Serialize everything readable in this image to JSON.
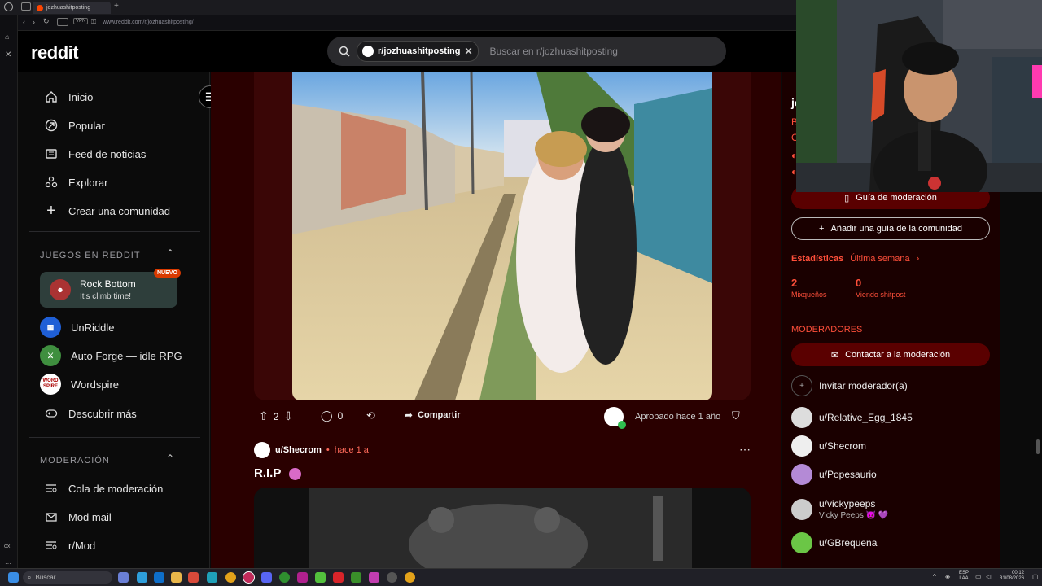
{
  "browser": {
    "tab_title": "jozhuashitposting",
    "url": "www.reddit.com/r/jozhuashitposting/"
  },
  "header": {
    "logo": "reddit",
    "search_chip": "r/jozhuashitposting",
    "search_placeholder": "Buscar en r/jozhuashitposting"
  },
  "sidebar": {
    "nav": [
      {
        "label": "Inicio",
        "icon": "home-icon"
      },
      {
        "label": "Popular",
        "icon": "popular-icon"
      },
      {
        "label": "Feed de noticias",
        "icon": "news-icon"
      },
      {
        "label": "Explorar",
        "icon": "explore-icon"
      },
      {
        "label": "Crear una comunidad",
        "icon": "plus-icon"
      }
    ],
    "games_header": "JUEGOS EN REDDIT",
    "games": [
      {
        "title": "Rock Bottom",
        "subtitle": "It's climb time!",
        "badge": "NUEVO"
      },
      {
        "title": "UnRiddle"
      },
      {
        "title": "Auto Forge — idle RPG"
      },
      {
        "title": "Wordspire",
        "icon_text": "WORD SPIRE"
      },
      {
        "title": "Descubrir más"
      }
    ],
    "mod_header": "MODERACIÓN",
    "mod": [
      {
        "label": "Cola de moderación"
      },
      {
        "label": "Mod mail"
      },
      {
        "label": "r/Mod"
      }
    ]
  },
  "post1": {
    "votes": "2",
    "comments": "0",
    "share": "Compartir",
    "approved": "Aprobado hace 1 año"
  },
  "post2": {
    "author": "u/Shecrom",
    "time": "hace 1 a",
    "title": "R.I.P"
  },
  "right": {
    "title_partial": "jo",
    "partial_letters": [
      "B",
      "C"
    ],
    "mod_guide": "Guía de moderación",
    "add_guide": "Añadir una guía de la comunidad",
    "stats_label": "Estadísticas",
    "stats_period": "Última semana",
    "stat1_value": "2",
    "stat1_label": "Mixqueños",
    "stat2_value": "0",
    "stat2_label": "Viendo shitpost",
    "mods_header": "MODERADORES",
    "contact_mods": "Contactar a la moderación",
    "invite": "Invitar moderador(a)",
    "mods": [
      {
        "name": "u/Relative_Egg_1845",
        "sub": ""
      },
      {
        "name": "u/Shecrom",
        "sub": ""
      },
      {
        "name": "u/Popesaurio",
        "sub": ""
      },
      {
        "name": "u/vickypeeps",
        "sub": "Vicky Peeps 😈 💜"
      },
      {
        "name": "u/GBrequena",
        "sub": ""
      }
    ]
  },
  "taskbar": {
    "search": "Buscar",
    "lang1": "ESP",
    "lang2": "LAA",
    "time": "00:12",
    "date": "31/08/2026"
  },
  "colors": {
    "accent": "#ff4f3a",
    "feed_bg": "#2a0000",
    "button_dark_red": "#5a0000"
  }
}
